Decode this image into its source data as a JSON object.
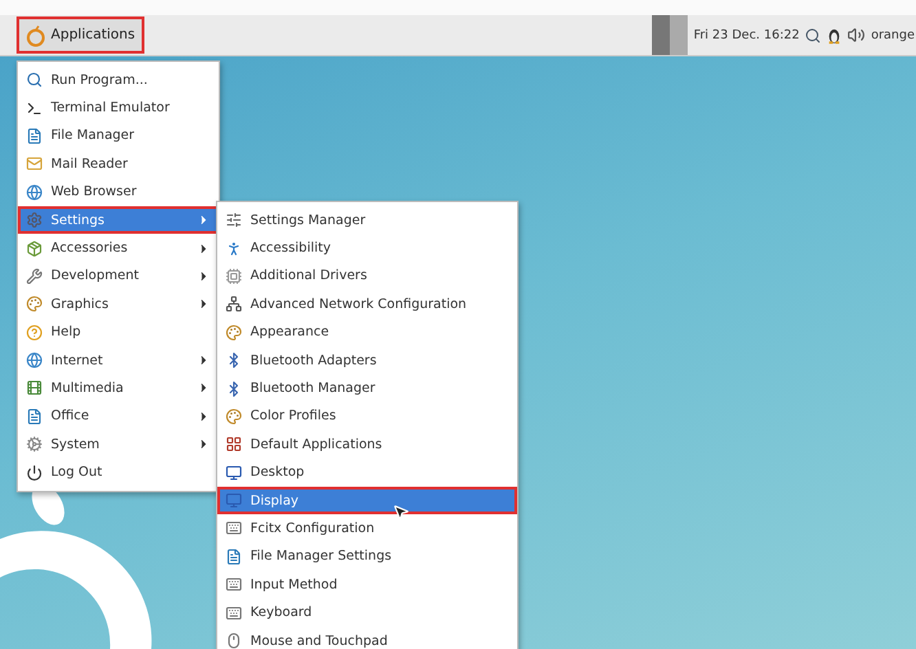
{
  "panel": {
    "applications_button": {
      "label": "Applications",
      "highlighted": true
    },
    "clock": "Fri 23 Dec. 16:22",
    "user": "orange"
  },
  "main_menu": [
    {
      "label": "Run Program...",
      "submenu": false,
      "selected": false,
      "highlighted": false
    },
    {
      "label": "Terminal Emulator",
      "submenu": false,
      "selected": false,
      "highlighted": false
    },
    {
      "label": "File Manager",
      "submenu": false,
      "selected": false,
      "highlighted": false
    },
    {
      "label": "Mail Reader",
      "submenu": false,
      "selected": false,
      "highlighted": false
    },
    {
      "label": "Web Browser",
      "submenu": false,
      "selected": false,
      "highlighted": false
    },
    {
      "label": "Settings",
      "submenu": true,
      "selected": true,
      "highlighted": true
    },
    {
      "label": "Accessories",
      "submenu": true,
      "selected": false,
      "highlighted": false
    },
    {
      "label": "Development",
      "submenu": true,
      "selected": false,
      "highlighted": false
    },
    {
      "label": "Graphics",
      "submenu": true,
      "selected": false,
      "highlighted": false
    },
    {
      "label": "Help",
      "submenu": false,
      "selected": false,
      "highlighted": false
    },
    {
      "label": "Internet",
      "submenu": true,
      "selected": false,
      "highlighted": false
    },
    {
      "label": "Multimedia",
      "submenu": true,
      "selected": false,
      "highlighted": false
    },
    {
      "label": "Office",
      "submenu": true,
      "selected": false,
      "highlighted": false
    },
    {
      "label": "System",
      "submenu": true,
      "selected": false,
      "highlighted": false
    },
    {
      "label": "Log Out",
      "submenu": false,
      "selected": false,
      "highlighted": false
    }
  ],
  "settings_menu": [
    {
      "label": "Settings Manager",
      "selected": false,
      "highlighted": false
    },
    {
      "label": "Accessibility",
      "selected": false,
      "highlighted": false
    },
    {
      "label": "Additional Drivers",
      "selected": false,
      "highlighted": false
    },
    {
      "label": "Advanced Network Configuration",
      "selected": false,
      "highlighted": false
    },
    {
      "label": "Appearance",
      "selected": false,
      "highlighted": false
    },
    {
      "label": "Bluetooth Adapters",
      "selected": false,
      "highlighted": false
    },
    {
      "label": "Bluetooth Manager",
      "selected": false,
      "highlighted": false
    },
    {
      "label": "Color Profiles",
      "selected": false,
      "highlighted": false
    },
    {
      "label": "Default Applications",
      "selected": false,
      "highlighted": false
    },
    {
      "label": "Desktop",
      "selected": false,
      "highlighted": false
    },
    {
      "label": "Display",
      "selected": true,
      "highlighted": true
    },
    {
      "label": "Fcitx Configuration",
      "selected": false,
      "highlighted": false
    },
    {
      "label": "File Manager Settings",
      "selected": false,
      "highlighted": false
    },
    {
      "label": "Input Method",
      "selected": false,
      "highlighted": false
    },
    {
      "label": "Keyboard",
      "selected": false,
      "highlighted": false
    },
    {
      "label": "Mouse and Touchpad",
      "selected": false,
      "highlighted": false
    }
  ]
}
